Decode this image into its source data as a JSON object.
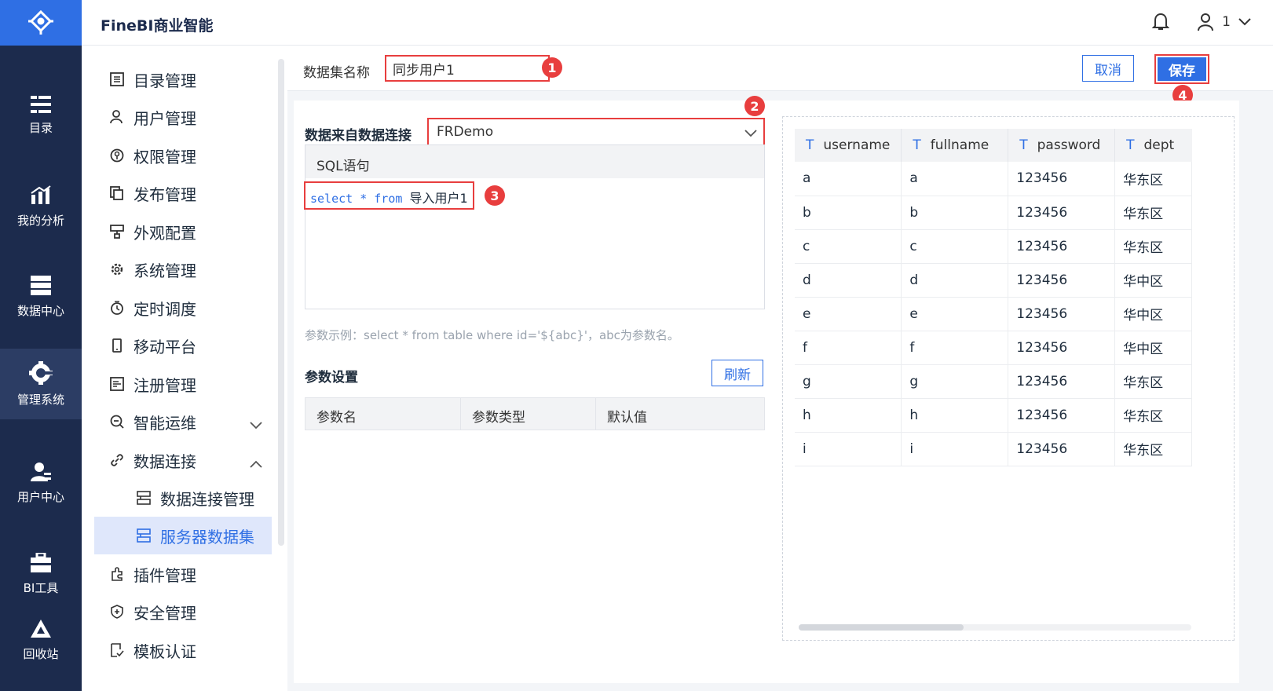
{
  "app": {
    "brand": "FineBI商业智能"
  },
  "header": {
    "user_name": "1"
  },
  "rail": {
    "items": [
      {
        "label": "目录",
        "icon": "list-icon"
      },
      {
        "label": "我的分析",
        "icon": "analysis-chart-icon"
      },
      {
        "label": "数据中心",
        "icon": "database-icon"
      },
      {
        "label": "管理系统",
        "icon": "gear-icon",
        "active": true
      },
      {
        "label": "用户中心",
        "icon": "user-group-icon"
      },
      {
        "label": "BI工具",
        "icon": "toolbox-icon"
      },
      {
        "label": "回收站",
        "icon": "recycle-icon"
      }
    ]
  },
  "menu": {
    "items": [
      {
        "label": "目录管理",
        "icon": "catalog-icon"
      },
      {
        "label": "用户管理",
        "icon": "user-icon"
      },
      {
        "label": "权限管理",
        "icon": "permission-icon"
      },
      {
        "label": "发布管理",
        "icon": "publish-icon"
      },
      {
        "label": "外观配置",
        "icon": "appearance-icon"
      },
      {
        "label": "系统管理",
        "icon": "system-gear-icon"
      },
      {
        "label": "定时调度",
        "icon": "timer-icon"
      },
      {
        "label": "移动平台",
        "icon": "mobile-icon"
      },
      {
        "label": "注册管理",
        "icon": "register-icon"
      },
      {
        "label": "智能运维",
        "icon": "ops-icon",
        "arrow": "chevron-down-icon"
      },
      {
        "label": "数据连接",
        "icon": "link-icon",
        "arrow": "chevron-up-icon"
      },
      {
        "label": "数据连接管理",
        "icon": "connection-manage-icon",
        "sub": true
      },
      {
        "label": "服务器数据集",
        "icon": "server-dataset-icon",
        "sub": true,
        "selected": true
      },
      {
        "label": "插件管理",
        "icon": "plugin-icon"
      },
      {
        "label": "安全管理",
        "icon": "shield-icon"
      },
      {
        "label": "模板认证",
        "icon": "template-cert-icon"
      }
    ]
  },
  "dataset": {
    "name_label": "数据集名称",
    "name_value": "同步用户1",
    "cancel_label": "取消",
    "save_label": "保存"
  },
  "source": {
    "label": "数据来自数据连接",
    "connection": "FRDemo",
    "sql_header": "SQL语句",
    "sql_keyword1": "select",
    "sql_star": "*",
    "sql_keyword2": "from",
    "sql_table": "导入用户1",
    "hint": "参数示例：select * from table where id='${abc}'，abc为参数名。"
  },
  "params": {
    "title": "参数设置",
    "refresh_label": "刷新",
    "columns": [
      "参数名",
      "参数类型",
      "默认值"
    ]
  },
  "badges": [
    "1",
    "2",
    "3",
    "4"
  ],
  "preview": {
    "columns": [
      "username",
      "fullname",
      "password",
      "dept"
    ],
    "rows": [
      [
        "a",
        "a",
        "123456",
        "华东区"
      ],
      [
        "b",
        "b",
        "123456",
        "华东区"
      ],
      [
        "c",
        "c",
        "123456",
        "华东区"
      ],
      [
        "d",
        "d",
        "123456",
        "华中区"
      ],
      [
        "e",
        "e",
        "123456",
        "华中区"
      ],
      [
        "f",
        "f",
        "123456",
        "华中区"
      ],
      [
        "g",
        "g",
        "123456",
        "华东区"
      ],
      [
        "h",
        "h",
        "123456",
        "华东区"
      ],
      [
        "i",
        "i",
        "123456",
        "华东区"
      ]
    ]
  },
  "colors": {
    "primary": "#2f6fe4",
    "rail": "#1c2b4d",
    "highlight": "#e83e3e"
  }
}
